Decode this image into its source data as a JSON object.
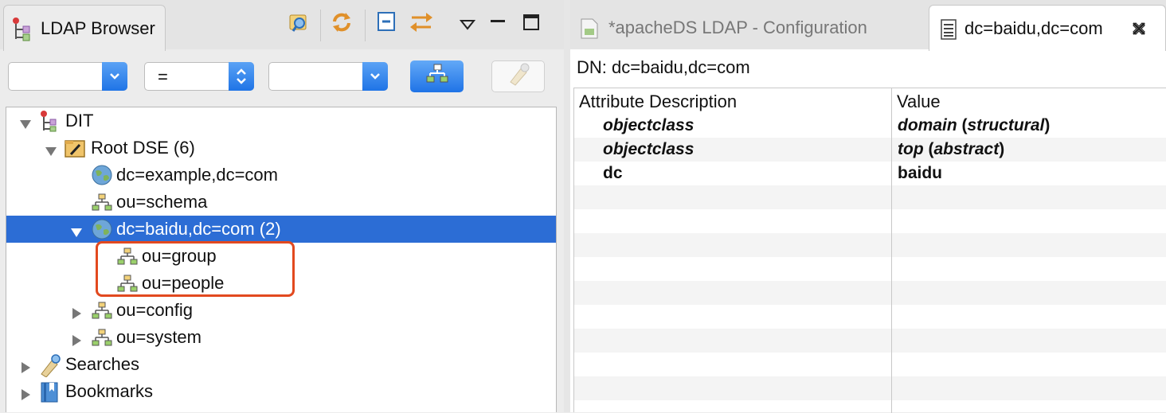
{
  "left_pane": {
    "tab_title": "LDAP Browser",
    "filter": {
      "attribute_value": "",
      "operator_value": "=",
      "value_value": ""
    },
    "tree": [
      {
        "label": "DIT",
        "icon": "dit-icon",
        "expanded": true
      },
      {
        "label": "Root DSE (6)",
        "icon": "root-dse-icon",
        "expanded": true
      },
      {
        "label": "dc=example,dc=com",
        "icon": "globe-icon"
      },
      {
        "label": "ou=schema",
        "icon": "ou-icon"
      },
      {
        "label": "dc=baidu,dc=com (2)",
        "icon": "globe-icon",
        "expanded": true,
        "selected": true
      },
      {
        "label": "ou=group",
        "icon": "ou-icon"
      },
      {
        "label": "ou=people",
        "icon": "ou-icon"
      },
      {
        "label": "ou=config",
        "icon": "ou-icon",
        "expanded": false
      },
      {
        "label": "ou=system",
        "icon": "ou-icon",
        "expanded": false
      },
      {
        "label": "Searches",
        "icon": "searches-icon",
        "expanded": false
      },
      {
        "label": "Bookmarks",
        "icon": "bookmarks-icon",
        "expanded": false
      }
    ],
    "highlight_color": "#e2491f",
    "selection_color": "#2c6dd5"
  },
  "right_pane": {
    "tabs": [
      {
        "label": "*apacheDS LDAP - Configuration",
        "icon": "config-file-icon"
      },
      {
        "label": "dc=baidu,dc=com",
        "icon": "entry-icon",
        "active": true
      }
    ],
    "dn_label": "DN: dc=baidu,dc=com",
    "table": {
      "headers": [
        "Attribute Description",
        "Value"
      ],
      "rows": [
        {
          "attribute": "objectclass",
          "value_main": "domain",
          "value_paren_open": " (",
          "value_type": "structural",
          "value_paren_close": ")"
        },
        {
          "attribute": "objectclass",
          "value_main": "top",
          "value_paren_open": " (",
          "value_type": "abstract",
          "value_paren_close": ")"
        },
        {
          "attribute": "dc",
          "value_main": "baidu",
          "value_paren_open": "",
          "value_type": "",
          "value_paren_close": ""
        }
      ]
    }
  }
}
